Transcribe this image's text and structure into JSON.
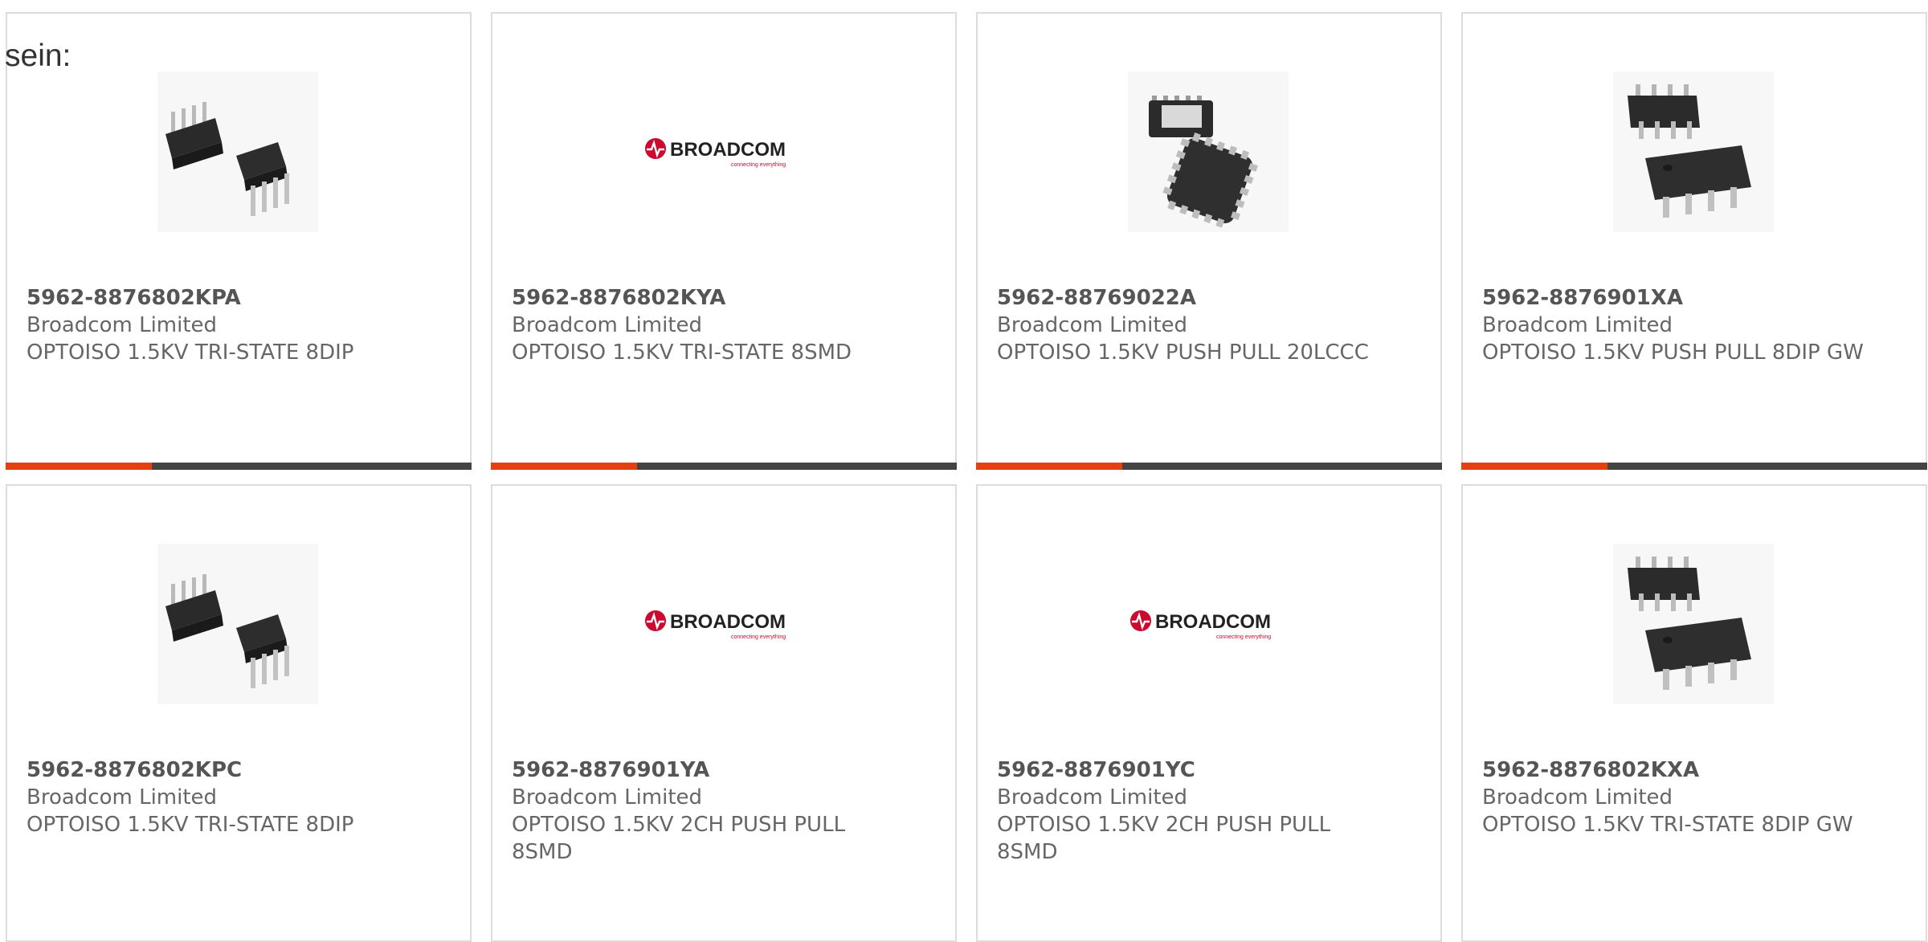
{
  "intro_text": "sein:",
  "colors": {
    "accent": "#e5400f",
    "bar_dark": "#444444"
  },
  "products": [
    {
      "part_number": "5962-8876802KPA",
      "manufacturer": "Broadcom Limited",
      "description": "OPTOISO 1.5KV TRI-STATE 8DIP",
      "image": "dip8-package-photo"
    },
    {
      "part_number": "5962-8876802KYA",
      "manufacturer": "Broadcom Limited",
      "description": "OPTOISO 1.5KV TRI-STATE 8SMD",
      "image": "broadcom-logo",
      "logo_text": "BROADCOM",
      "logo_tagline": "connecting everything"
    },
    {
      "part_number": "5962-88769022A",
      "manufacturer": "Broadcom Limited",
      "description": "OPTOISO 1.5KV PUSH PULL 20LCCC",
      "image": "lccc20-package-photo"
    },
    {
      "part_number": "5962-8876901XA",
      "manufacturer": "Broadcom Limited",
      "description": "OPTOISO 1.5KV PUSH PULL 8DIP GW",
      "image": "dip8-gullwing-package-photo"
    },
    {
      "part_number": "5962-8876802KPC",
      "manufacturer": "Broadcom Limited",
      "description": "OPTOISO 1.5KV TRI-STATE 8DIP",
      "image": "dip8-package-photo"
    },
    {
      "part_number": "5962-8876901YA",
      "manufacturer": "Broadcom Limited",
      "description": "OPTOISO 1.5KV 2CH PUSH PULL 8SMD",
      "image": "broadcom-logo",
      "logo_text": "BROADCOM",
      "logo_tagline": "connecting everything"
    },
    {
      "part_number": "5962-8876901YC",
      "manufacturer": "Broadcom Limited",
      "description": "OPTOISO 1.5KV 2CH PUSH PULL 8SMD",
      "image": "broadcom-logo",
      "logo_text": "BROADCOM",
      "logo_tagline": "connecting everything"
    },
    {
      "part_number": "5962-8876802KXA",
      "manufacturer": "Broadcom Limited",
      "description": "OPTOISO 1.5KV TRI-STATE 8DIP GW",
      "image": "dip8-gullwing-package-photo"
    }
  ]
}
